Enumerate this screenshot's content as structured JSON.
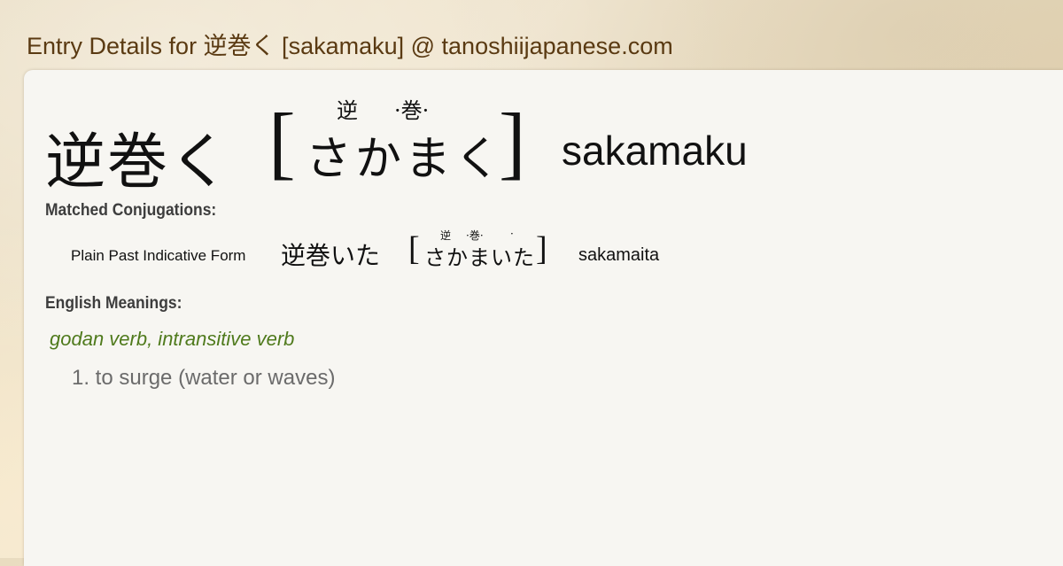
{
  "page": {
    "title": "Entry Details for 逆巻く [sakamaku] @ tanoshiijapanese.com"
  },
  "entry": {
    "headword": "逆巻く",
    "bracket_open": "[",
    "bracket_close": "]",
    "reading": "さかまく",
    "furigana": [
      "逆",
      "·巻·"
    ],
    "romaji": "sakamaku"
  },
  "conjugations": {
    "label": "Matched Conjugations:",
    "items": [
      {
        "form": "Plain Past Indicative Form",
        "word": "逆巻いた",
        "reading": "さかまいた",
        "furigana": [
          "逆",
          "·巻·",
          "·"
        ],
        "romaji": "sakamaita"
      }
    ]
  },
  "meanings": {
    "label": "English Meanings:",
    "part_of_speech": "godan verb, intransitive verb",
    "items": [
      "1. to surge (water or waves)"
    ]
  },
  "colors": {
    "title": "#5a3a12",
    "part_of_speech": "#4f7a1c",
    "meaning_text": "#6b6b6b",
    "card_bg": "#f7f6f2"
  }
}
